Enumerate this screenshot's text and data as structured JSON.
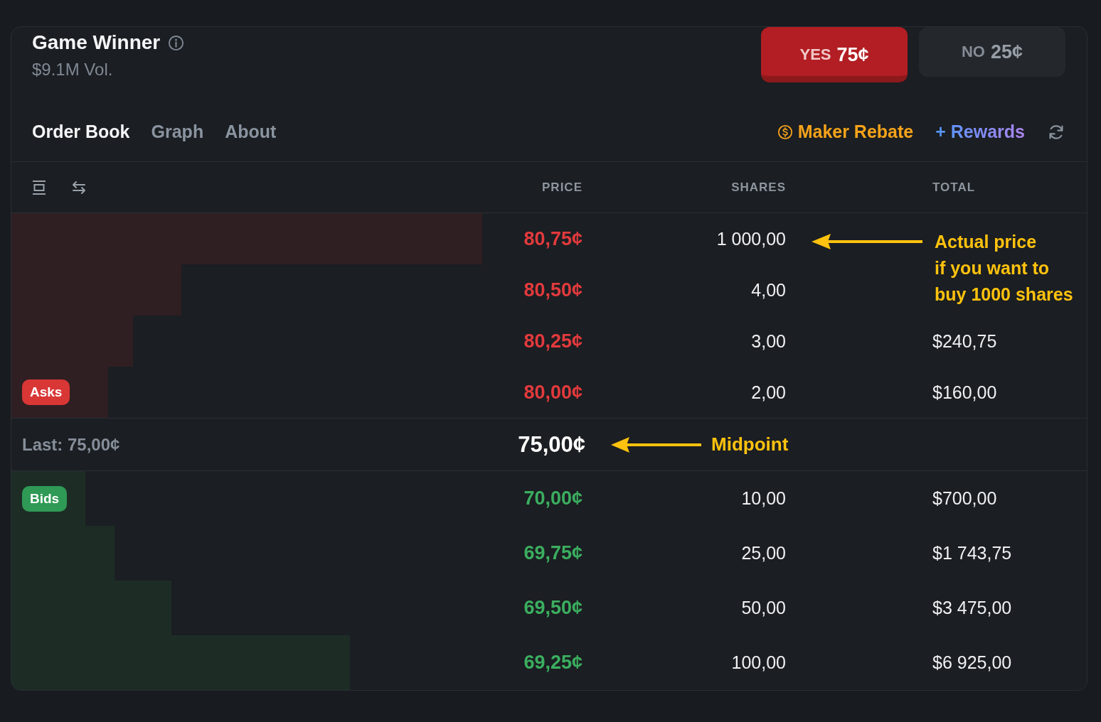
{
  "market": {
    "title": "Game Winner",
    "volume": "$9.1M Vol."
  },
  "outcomes": [
    {
      "label": "YES",
      "price": "75¢",
      "selected": true
    },
    {
      "label": "NO",
      "price": "25¢",
      "selected": false
    }
  ],
  "tabs": [
    {
      "label": "Order Book",
      "selected": true
    },
    {
      "label": "Graph",
      "selected": false
    },
    {
      "label": "About",
      "selected": false
    }
  ],
  "links": [
    {
      "kind": "rebate",
      "label": "Maker Rebate"
    },
    {
      "kind": "rewards",
      "label": "+ Rewards"
    }
  ],
  "order_book": {
    "columns": [
      "PRICE",
      "SHARES",
      "TOTAL"
    ],
    "asks": {
      "badge": "Asks",
      "rows": [
        {
          "price": "80,75¢",
          "shares": "1 000,00",
          "level": 0.438,
          "callout": "Actual price\nif you want to\nbuy 1000 shares"
        },
        {
          "price": "80,50¢",
          "shares": "4,00",
          "level": 0.158
        },
        {
          "price": "80,25¢",
          "shares": "3,00",
          "total": "$240,75",
          "level": 0.113
        },
        {
          "price": "80,00¢",
          "shares": "2,00",
          "total": "$160,00",
          "level": 0.09
        }
      ]
    },
    "midpoint": {
      "last": "Last: 75,00¢",
      "price": "75,00¢",
      "callout": "Midpoint"
    },
    "bids": {
      "badge": "Bids",
      "rows": [
        {
          "price": "70,00¢",
          "shares": "10,00",
          "total": "$700,00",
          "level": 0.069
        },
        {
          "price": "69,75¢",
          "shares": "25,00",
          "total": "$1 743,75",
          "level": 0.096
        },
        {
          "price": "69,50¢",
          "shares": "50,00",
          "total": "$3 475,00",
          "level": 0.149
        },
        {
          "price": "69,25¢",
          "shares": "100,00",
          "total": "$6 925,00",
          "level": 0.315
        }
      ]
    }
  }
}
